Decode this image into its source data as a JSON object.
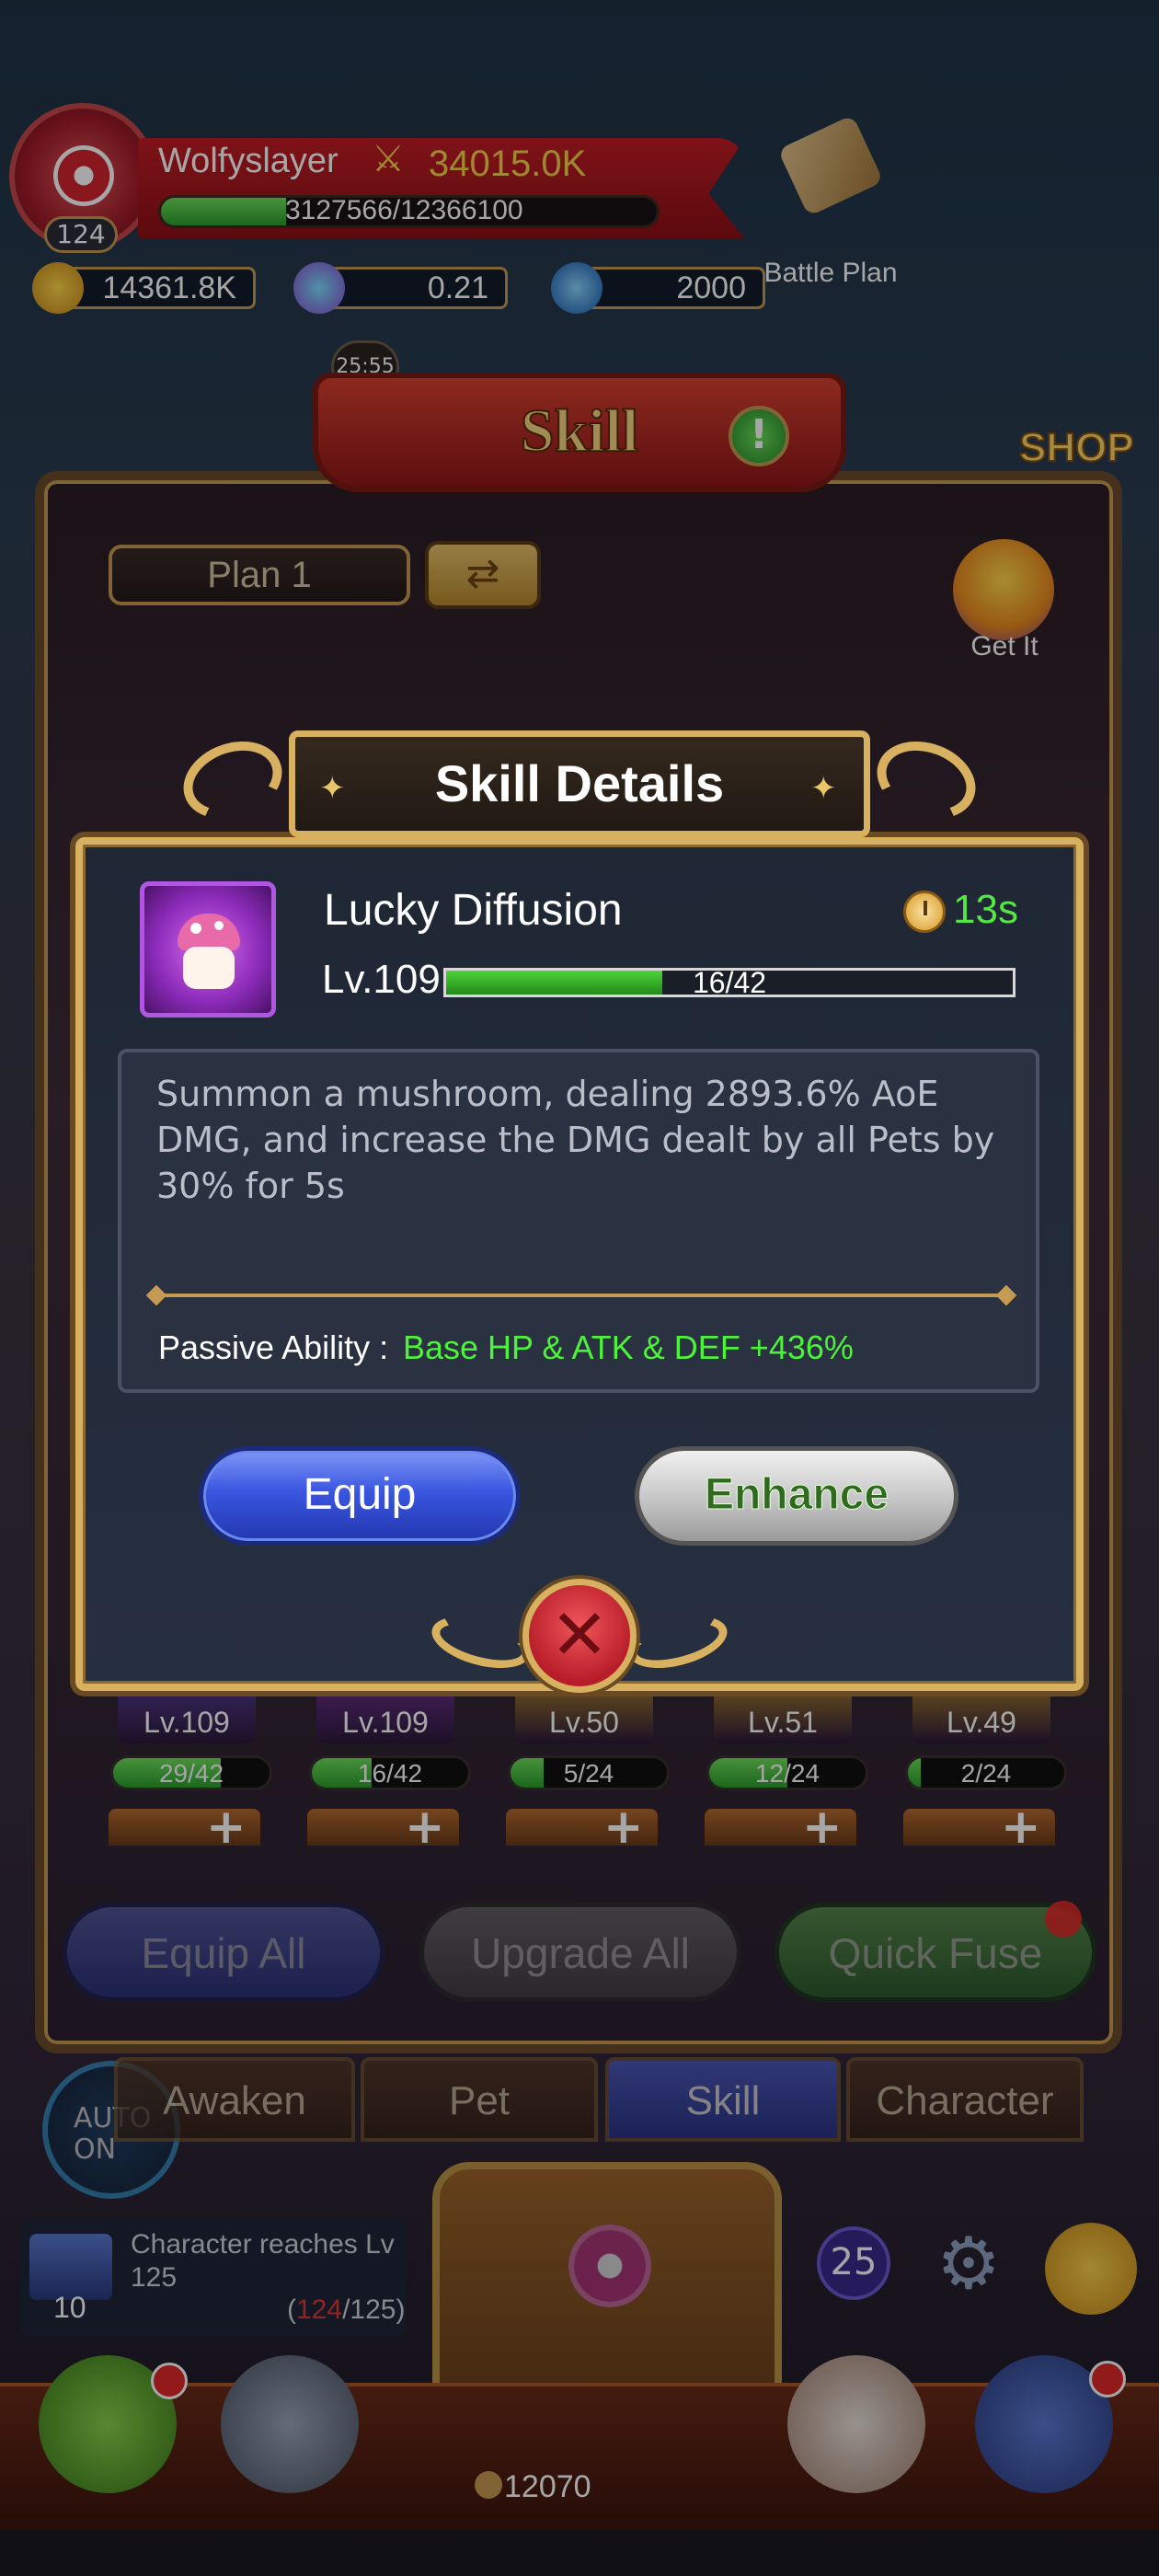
{
  "hud": {
    "player_name": "Wolfyslayer",
    "level": "124",
    "power": "34015.0K",
    "xp_text": "3127566/12366100",
    "xp_progress": 0.253,
    "battle_plan_label": "Battle Plan",
    "currencies": [
      {
        "icon": "coin-icon",
        "value": "14361.8K"
      },
      {
        "icon": "star-gem-icon",
        "value": "0.21"
      },
      {
        "icon": "diamond-icon",
        "value": "2000"
      }
    ],
    "timer": "25:55",
    "shop_label": "SHOP"
  },
  "skill_panel": {
    "title": "Skill",
    "plan_label": "Plan 1",
    "get_it_label": "Get It",
    "skills": [
      {
        "level": "Lv.109",
        "progress_text": "29/42",
        "progress": 0.69,
        "color": "#6a4ab8"
      },
      {
        "level": "Lv.109",
        "progress_text": "16/42",
        "progress": 0.38,
        "color": "#8a3ab0"
      },
      {
        "level": "Lv.50",
        "progress_text": "5/24",
        "progress": 0.21,
        "color": "#d9a42a"
      },
      {
        "level": "Lv.51",
        "progress_text": "12/24",
        "progress": 0.5,
        "color": "#d9a42a"
      },
      {
        "level": "Lv.49",
        "progress_text": "2/24",
        "progress": 0.08,
        "color": "#d9a42a"
      }
    ],
    "buttons": {
      "equip_all": "Equip All",
      "upgrade_all": "Upgrade All",
      "quick_fuse": "Quick Fuse"
    }
  },
  "tabs": [
    {
      "label": "Awaken",
      "active": false
    },
    {
      "label": "Pet",
      "active": false
    },
    {
      "label": "Skill",
      "active": true
    },
    {
      "label": "Character",
      "active": false
    }
  ],
  "auto_label": "AUTO ON",
  "quest": {
    "number": "10",
    "text": "Character reaches Lv 125",
    "current": "124",
    "target": "/125)",
    "open_paren": "("
  },
  "bottom": {
    "badge_count": "25",
    "chest_count": "12070"
  },
  "modal": {
    "title": "Skill Details",
    "skill_name": "Lucky Diffusion",
    "cooldown": "13s",
    "level": "Lv.109",
    "progress_text": "16/42",
    "progress": 0.381,
    "description": "Summon a mushroom, dealing 2893.6% AoE DMG, and increase the DMG dealt by all Pets by 30% for 5s",
    "passive_label": "Passive Ability :",
    "passive_value": "Base HP & ATK & DEF +436%",
    "equip_label": "Equip",
    "enhance_label": "Enhance"
  }
}
